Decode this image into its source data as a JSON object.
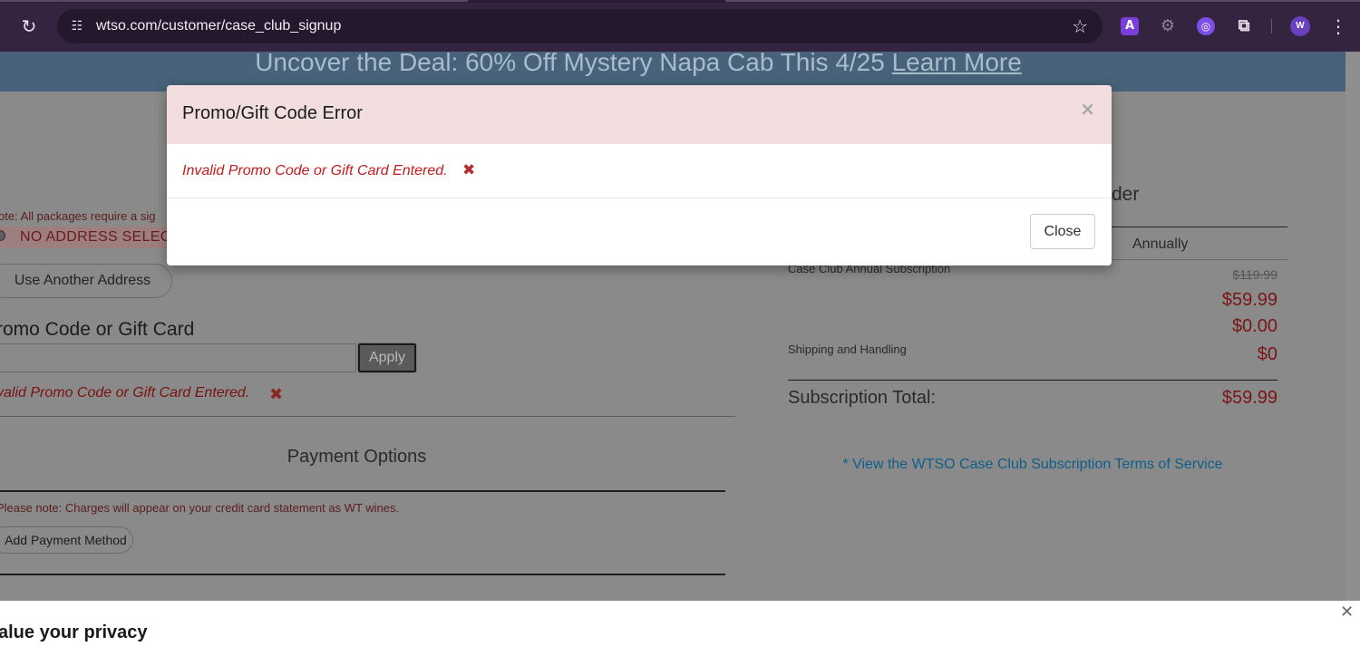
{
  "browser": {
    "url": "wtso.com/customer/case_club_signup",
    "icons": [
      "reload-icon",
      "site-info-icon",
      "star-icon",
      "extension-a-icon",
      "extension-robot-icon",
      "extension-swirl-icon",
      "extensions-puzzle-icon",
      "menu-kebab-icon"
    ],
    "profile_initial": "W",
    "ext_a_label": "A"
  },
  "banner": {
    "text": "Uncover the Deal: 60% Off Mystery Napa Cab This 4/25 ",
    "link": "Learn More"
  },
  "checkout": {
    "signature_note": "ote: All packages require a sig",
    "address_status": "NO ADDRESS SELEC",
    "use_another_address": "Use Another Address",
    "promo_label": "romo Code or Gift Card",
    "promo_value": "",
    "apply_label": "Apply",
    "promo_error": "valid Promo Code or Gift Card Entered.",
    "payment_title": "Payment Options",
    "payment_note": "Please note: Charges will appear on your credit card statement as WT wines.",
    "add_payment": "Add Payment Method"
  },
  "order": {
    "title_tail": "der",
    "frequency": "Annually",
    "subscription_label": "Case Club Annual Subscription",
    "original_price": "$119.99",
    "sale_price": "$59.99",
    "discount_line": "$0.00",
    "shipping_label": "Shipping and Handling",
    "shipping_value": "$0",
    "total_label": "Subscription Total:",
    "total_value": "$59.99",
    "tos_link": "* View the WTSO Case Club Subscription Terms of Service"
  },
  "modal": {
    "title": "Promo/Gift Code Error",
    "message": "Invalid Promo Code or Gift Card Entered.",
    "close_label": "Close",
    "close_x": "×"
  },
  "privacy": {
    "title": "alue your privacy"
  },
  "colors": {
    "browser_bar": "#35243f",
    "banner": "#47627a",
    "modal_header": "#f2dede",
    "error_text": "#c41b1b",
    "price_text": "#7b1515",
    "link": "#0f5f8a"
  }
}
